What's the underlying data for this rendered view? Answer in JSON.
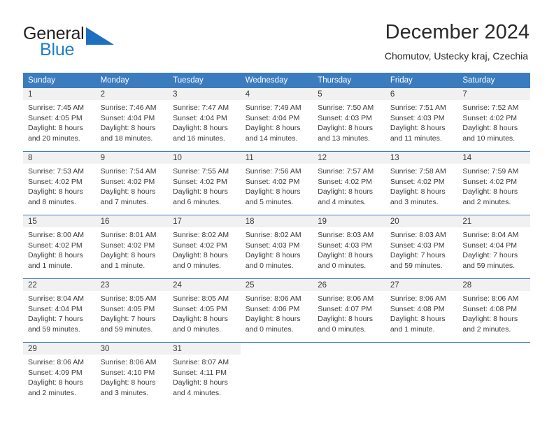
{
  "brand": {
    "name_top": "General",
    "name_bottom": "Blue",
    "color_top": "#231f20",
    "color_bottom": "#1f7fc4",
    "triangle_color": "#1f6fc0"
  },
  "header": {
    "title": "December 2024",
    "subtitle": "Chomutov, Ustecky kraj, Czechia"
  },
  "theme": {
    "header_bg": "#3b7cbf",
    "header_text": "#ffffff",
    "daynum_bg": "#f1f1f1",
    "body_text": "#3a3a3a"
  },
  "calendar": {
    "weekday_headers": [
      "Sunday",
      "Monday",
      "Tuesday",
      "Wednesday",
      "Thursday",
      "Friday",
      "Saturday"
    ],
    "weeks": [
      [
        {
          "day": "1",
          "sunrise": "Sunrise: 7:45 AM",
          "sunset": "Sunset: 4:05 PM",
          "daylight1": "Daylight: 8 hours",
          "daylight2": "and 20 minutes."
        },
        {
          "day": "2",
          "sunrise": "Sunrise: 7:46 AM",
          "sunset": "Sunset: 4:04 PM",
          "daylight1": "Daylight: 8 hours",
          "daylight2": "and 18 minutes."
        },
        {
          "day": "3",
          "sunrise": "Sunrise: 7:47 AM",
          "sunset": "Sunset: 4:04 PM",
          "daylight1": "Daylight: 8 hours",
          "daylight2": "and 16 minutes."
        },
        {
          "day": "4",
          "sunrise": "Sunrise: 7:49 AM",
          "sunset": "Sunset: 4:04 PM",
          "daylight1": "Daylight: 8 hours",
          "daylight2": "and 14 minutes."
        },
        {
          "day": "5",
          "sunrise": "Sunrise: 7:50 AM",
          "sunset": "Sunset: 4:03 PM",
          "daylight1": "Daylight: 8 hours",
          "daylight2": "and 13 minutes."
        },
        {
          "day": "6",
          "sunrise": "Sunrise: 7:51 AM",
          "sunset": "Sunset: 4:03 PM",
          "daylight1": "Daylight: 8 hours",
          "daylight2": "and 11 minutes."
        },
        {
          "day": "7",
          "sunrise": "Sunrise: 7:52 AM",
          "sunset": "Sunset: 4:02 PM",
          "daylight1": "Daylight: 8 hours",
          "daylight2": "and 10 minutes."
        }
      ],
      [
        {
          "day": "8",
          "sunrise": "Sunrise: 7:53 AM",
          "sunset": "Sunset: 4:02 PM",
          "daylight1": "Daylight: 8 hours",
          "daylight2": "and 8 minutes."
        },
        {
          "day": "9",
          "sunrise": "Sunrise: 7:54 AM",
          "sunset": "Sunset: 4:02 PM",
          "daylight1": "Daylight: 8 hours",
          "daylight2": "and 7 minutes."
        },
        {
          "day": "10",
          "sunrise": "Sunrise: 7:55 AM",
          "sunset": "Sunset: 4:02 PM",
          "daylight1": "Daylight: 8 hours",
          "daylight2": "and 6 minutes."
        },
        {
          "day": "11",
          "sunrise": "Sunrise: 7:56 AM",
          "sunset": "Sunset: 4:02 PM",
          "daylight1": "Daylight: 8 hours",
          "daylight2": "and 5 minutes."
        },
        {
          "day": "12",
          "sunrise": "Sunrise: 7:57 AM",
          "sunset": "Sunset: 4:02 PM",
          "daylight1": "Daylight: 8 hours",
          "daylight2": "and 4 minutes."
        },
        {
          "day": "13",
          "sunrise": "Sunrise: 7:58 AM",
          "sunset": "Sunset: 4:02 PM",
          "daylight1": "Daylight: 8 hours",
          "daylight2": "and 3 minutes."
        },
        {
          "day": "14",
          "sunrise": "Sunrise: 7:59 AM",
          "sunset": "Sunset: 4:02 PM",
          "daylight1": "Daylight: 8 hours",
          "daylight2": "and 2 minutes."
        }
      ],
      [
        {
          "day": "15",
          "sunrise": "Sunrise: 8:00 AM",
          "sunset": "Sunset: 4:02 PM",
          "daylight1": "Daylight: 8 hours",
          "daylight2": "and 1 minute."
        },
        {
          "day": "16",
          "sunrise": "Sunrise: 8:01 AM",
          "sunset": "Sunset: 4:02 PM",
          "daylight1": "Daylight: 8 hours",
          "daylight2": "and 1 minute."
        },
        {
          "day": "17",
          "sunrise": "Sunrise: 8:02 AM",
          "sunset": "Sunset: 4:02 PM",
          "daylight1": "Daylight: 8 hours",
          "daylight2": "and 0 minutes."
        },
        {
          "day": "18",
          "sunrise": "Sunrise: 8:02 AM",
          "sunset": "Sunset: 4:03 PM",
          "daylight1": "Daylight: 8 hours",
          "daylight2": "and 0 minutes."
        },
        {
          "day": "19",
          "sunrise": "Sunrise: 8:03 AM",
          "sunset": "Sunset: 4:03 PM",
          "daylight1": "Daylight: 8 hours",
          "daylight2": "and 0 minutes."
        },
        {
          "day": "20",
          "sunrise": "Sunrise: 8:03 AM",
          "sunset": "Sunset: 4:03 PM",
          "daylight1": "Daylight: 7 hours",
          "daylight2": "and 59 minutes."
        },
        {
          "day": "21",
          "sunrise": "Sunrise: 8:04 AM",
          "sunset": "Sunset: 4:04 PM",
          "daylight1": "Daylight: 7 hours",
          "daylight2": "and 59 minutes."
        }
      ],
      [
        {
          "day": "22",
          "sunrise": "Sunrise: 8:04 AM",
          "sunset": "Sunset: 4:04 PM",
          "daylight1": "Daylight: 7 hours",
          "daylight2": "and 59 minutes."
        },
        {
          "day": "23",
          "sunrise": "Sunrise: 8:05 AM",
          "sunset": "Sunset: 4:05 PM",
          "daylight1": "Daylight: 7 hours",
          "daylight2": "and 59 minutes."
        },
        {
          "day": "24",
          "sunrise": "Sunrise: 8:05 AM",
          "sunset": "Sunset: 4:05 PM",
          "daylight1": "Daylight: 8 hours",
          "daylight2": "and 0 minutes."
        },
        {
          "day": "25",
          "sunrise": "Sunrise: 8:06 AM",
          "sunset": "Sunset: 4:06 PM",
          "daylight1": "Daylight: 8 hours",
          "daylight2": "and 0 minutes."
        },
        {
          "day": "26",
          "sunrise": "Sunrise: 8:06 AM",
          "sunset": "Sunset: 4:07 PM",
          "daylight1": "Daylight: 8 hours",
          "daylight2": "and 0 minutes."
        },
        {
          "day": "27",
          "sunrise": "Sunrise: 8:06 AM",
          "sunset": "Sunset: 4:08 PM",
          "daylight1": "Daylight: 8 hours",
          "daylight2": "and 1 minute."
        },
        {
          "day": "28",
          "sunrise": "Sunrise: 8:06 AM",
          "sunset": "Sunset: 4:08 PM",
          "daylight1": "Daylight: 8 hours",
          "daylight2": "and 2 minutes."
        }
      ],
      [
        {
          "day": "29",
          "sunrise": "Sunrise: 8:06 AM",
          "sunset": "Sunset: 4:09 PM",
          "daylight1": "Daylight: 8 hours",
          "daylight2": "and 2 minutes."
        },
        {
          "day": "30",
          "sunrise": "Sunrise: 8:06 AM",
          "sunset": "Sunset: 4:10 PM",
          "daylight1": "Daylight: 8 hours",
          "daylight2": "and 3 minutes."
        },
        {
          "day": "31",
          "sunrise": "Sunrise: 8:07 AM",
          "sunset": "Sunset: 4:11 PM",
          "daylight1": "Daylight: 8 hours",
          "daylight2": "and 4 minutes."
        },
        {
          "day": "",
          "sunrise": "",
          "sunset": "",
          "daylight1": "",
          "daylight2": ""
        },
        {
          "day": "",
          "sunrise": "",
          "sunset": "",
          "daylight1": "",
          "daylight2": ""
        },
        {
          "day": "",
          "sunrise": "",
          "sunset": "",
          "daylight1": "",
          "daylight2": ""
        },
        {
          "day": "",
          "sunrise": "",
          "sunset": "",
          "daylight1": "",
          "daylight2": ""
        }
      ]
    ]
  }
}
